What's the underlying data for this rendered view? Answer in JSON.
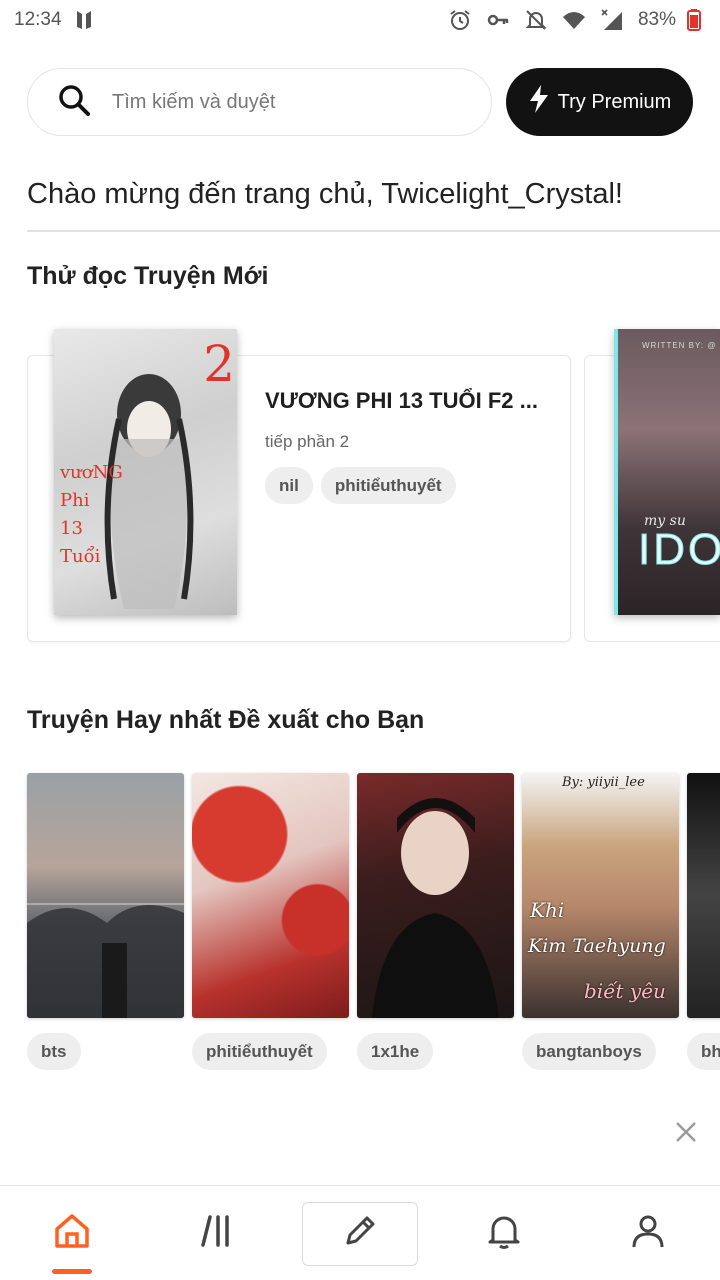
{
  "status_bar": {
    "time": "12:34",
    "battery": "83%"
  },
  "search": {
    "placeholder": "Tìm kiếm và duyệt"
  },
  "premium": {
    "label": "Try Premium"
  },
  "welcome": "Chào mừng đến trang chủ, Twicelight_Crystal!",
  "section_new": {
    "title": "Thử đọc Truyện Mới"
  },
  "featured_story": {
    "title": "VƯƠNG PHI 13 TUỔI F2 ...",
    "subtitle": "tiếp phần 2",
    "tags": [
      "nil",
      "phitiểuthuyết"
    ],
    "cover_text": {
      "number": "2",
      "side": "vươNG Phi 13 Tuổi"
    }
  },
  "second_story": {
    "cover_text": {
      "top": "WRITTEN BY: @",
      "script": "my su",
      "big": "IDO"
    }
  },
  "section_recommend": {
    "title": "Truyện Hay nhất Đề xuất cho Bạn"
  },
  "recommended": [
    {
      "tag": "bts"
    },
    {
      "tag": "phitiểuthuyết"
    },
    {
      "tag": "1x1he"
    },
    {
      "tag": "bangtanboys",
      "cover_text": {
        "top": "By: yiiyii_lee",
        "line1": "Khi",
        "line2": "Kim Taehyung",
        "line3": "biết yêu"
      }
    },
    {
      "tag": "bh"
    }
  ],
  "colors": {
    "accent": "#ff6122",
    "premium_bg": "#121212",
    "chip_bg": "#eeeeee"
  },
  "nav": {
    "items": [
      {
        "name": "home",
        "icon": "home-icon",
        "active": true
      },
      {
        "name": "library",
        "icon": "library-icon"
      },
      {
        "name": "write",
        "icon": "pencil-icon"
      },
      {
        "name": "notifications",
        "icon": "bell-icon"
      },
      {
        "name": "profile",
        "icon": "person-icon"
      }
    ]
  }
}
